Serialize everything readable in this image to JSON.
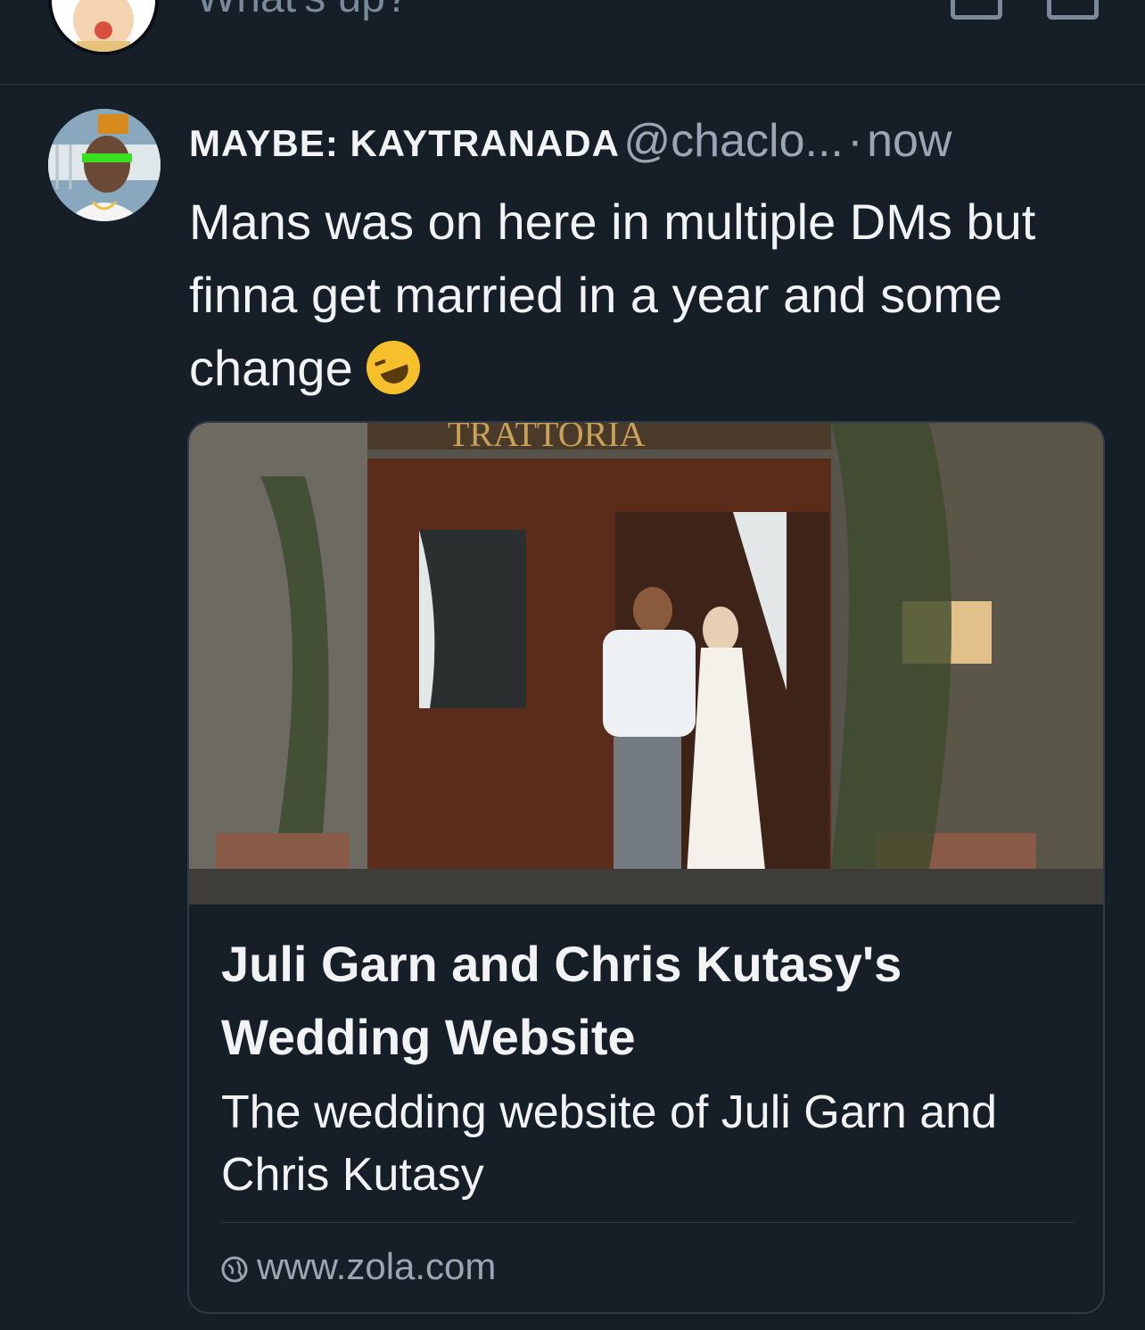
{
  "composer": {
    "placeholder": "What's up?",
    "icons": [
      "image-icon",
      "mail-icon"
    ]
  },
  "post": {
    "author_display_name": "MAYBE: KAYTRANADA",
    "author_handle": "@chaclo...",
    "separator": "·",
    "timestamp": "now",
    "text": "Mans was on here in multiple DMs but finna get married in a year and some change",
    "emoji": "rolling-on-floor-laughing-emoji",
    "link_card": {
      "image_alt": "Couple standing in front of a trattoria doorway",
      "image_sign_text": "TRATTORIA",
      "title": "Juli Garn and Chris Kutasy's Wedding Website",
      "description": "The wedding website of Juli Garn and Chris Kutasy",
      "domain": "www.zola.com"
    }
  },
  "colors": {
    "background": "#161e27",
    "border": "#2e3a47",
    "text_primary": "#f1f3f5",
    "text_secondary": "#9aa6b3"
  }
}
